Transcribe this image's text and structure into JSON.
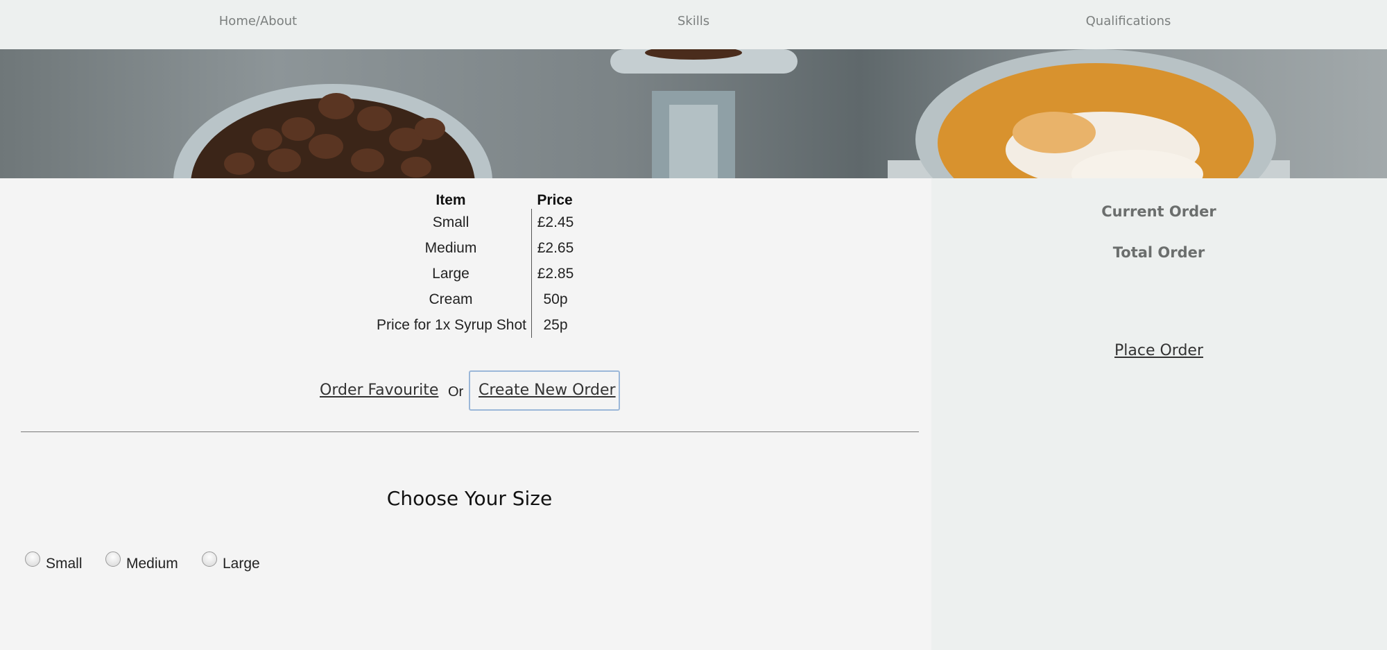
{
  "nav": {
    "items": [
      {
        "label": "Home/About"
      },
      {
        "label": "Skills"
      },
      {
        "label": "Qualifications"
      }
    ]
  },
  "hero": {
    "image_subject": "coffee beans and latte art banner"
  },
  "price_table": {
    "headers": {
      "item": "Item",
      "price": "Price"
    },
    "rows": [
      {
        "item": "Small",
        "price": "£2.45"
      },
      {
        "item": "Medium",
        "price": "£2.65"
      },
      {
        "item": "Large",
        "price": "£2.85"
      },
      {
        "item": "Cream",
        "price": "50p"
      },
      {
        "item": "Price for 1x Syrup Shot",
        "price": "25p"
      }
    ]
  },
  "actions": {
    "order_favourite": "Order Favourite",
    "or": "Or",
    "create_new_order": "Create New Order"
  },
  "size_section": {
    "heading": "Choose Your Size",
    "options": [
      {
        "label": "Small"
      },
      {
        "label": "Medium"
      },
      {
        "label": "Large"
      }
    ]
  },
  "sidebar": {
    "current_order": "Current Order",
    "total_order": "Total Order",
    "place_order": "Place Order"
  },
  "colors": {
    "nav_bg": "#edf0ef",
    "main_bg": "#f4f4f4",
    "sidebar_bg": "#edf0ef",
    "focus_outline": "#9bb7d8"
  }
}
